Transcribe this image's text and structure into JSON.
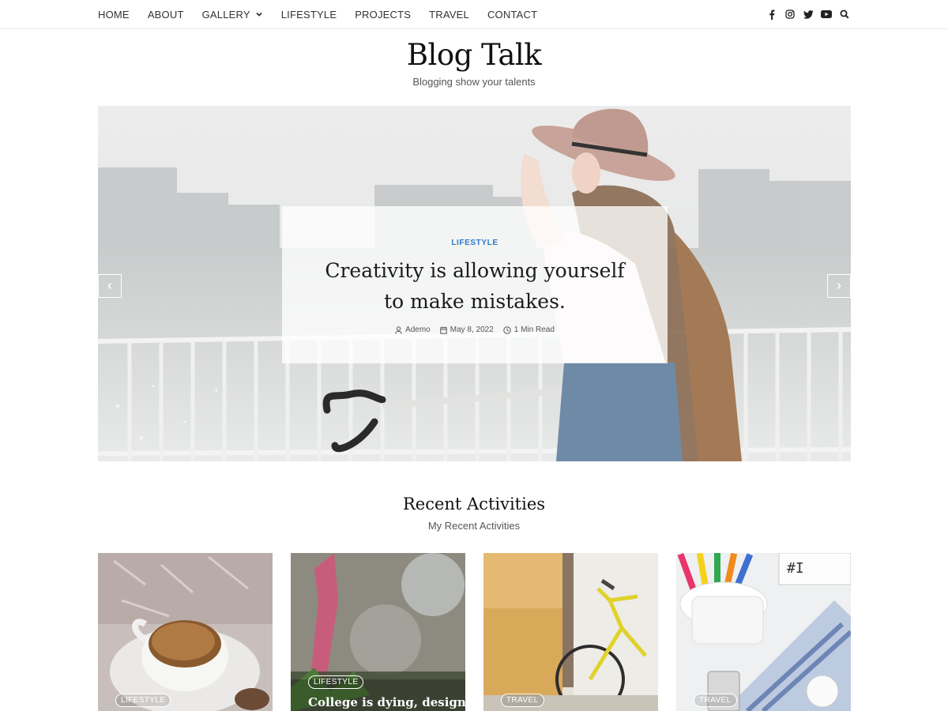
{
  "nav": {
    "items": [
      "HOME",
      "ABOUT",
      "GALLERY",
      "LIFESTYLE",
      "PROJECTS",
      "TRAVEL",
      "CONTACT"
    ],
    "social_icons": [
      "facebook-icon",
      "instagram-icon",
      "twitter-icon",
      "youtube-icon",
      "search-icon"
    ]
  },
  "site": {
    "title": "Blog Talk",
    "tagline": "Blogging show your talents"
  },
  "hero": {
    "category": "LIFESTYLE",
    "title": "Creativity is allowing yourself to make mistakes.",
    "author": "Ademo",
    "date": "May 8, 2022",
    "read_time": "1 Min Read"
  },
  "recent": {
    "title": "Recent Activities",
    "subtitle": "My Recent Activities",
    "cards": [
      {
        "category": "LIFESTYLE",
        "title": ""
      },
      {
        "category": "LIFESTYLE",
        "title": "College is dying, design"
      },
      {
        "category": "TRAVEL",
        "title": ""
      },
      {
        "category": "TRAVEL",
        "title": ""
      }
    ]
  },
  "colors": {
    "accent": "#2b79c9",
    "text": "#222222"
  }
}
